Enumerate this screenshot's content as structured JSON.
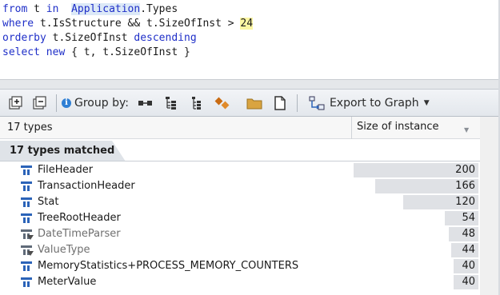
{
  "editor": {
    "lines": [
      [
        {
          "t": "from",
          "c": "kw"
        },
        {
          "t": " t ",
          "c": ""
        },
        {
          "t": "in",
          "c": "kw"
        },
        {
          "t": "  ",
          "c": ""
        },
        {
          "t": "Application",
          "c": "hl"
        },
        {
          "t": ".Types",
          "c": ""
        }
      ],
      [
        {
          "t": "where",
          "c": "kw"
        },
        {
          "t": " t.IsStructure && t.SizeOfInst > ",
          "c": ""
        },
        {
          "t": "24",
          "c": "num"
        }
      ],
      [
        {
          "t": "orderby",
          "c": "kw"
        },
        {
          "t": " t.SizeOfInst ",
          "c": ""
        },
        {
          "t": "descending",
          "c": "kw"
        }
      ],
      [
        {
          "t": "select",
          "c": "kw"
        },
        {
          "t": " ",
          "c": ""
        },
        {
          "t": "new",
          "c": "kw"
        },
        {
          "t": " { t, t.SizeOfInst }",
          "c": ""
        }
      ]
    ]
  },
  "toolbar": {
    "group_by_label": "Group by:",
    "export_label": "Export to Graph",
    "icons": [
      "expand-all-icon",
      "collapse-all-icon",
      "info-icon",
      "group-by-assembly-icon",
      "group-by-namespace-icon",
      "group-by-type-icon",
      "group-by-member-icon",
      "folder-icon",
      "document-icon",
      "export-graph-icon",
      "chevron-down-icon"
    ]
  },
  "grid": {
    "col_name_header": "17 types",
    "col_size_header": "Size of instance",
    "group_label": "17 types matched",
    "max_value": 200,
    "rows": [
      {
        "name": "FileHeader",
        "value": "200",
        "num": 200,
        "dim": false,
        "overlay": false
      },
      {
        "name": "TransactionHeader",
        "value": "166",
        "num": 166,
        "dim": false,
        "overlay": false
      },
      {
        "name": "Stat",
        "value": "120",
        "num": 120,
        "dim": false,
        "overlay": false
      },
      {
        "name": "TreeRootHeader",
        "value": "54",
        "num": 54,
        "dim": false,
        "overlay": false
      },
      {
        "name": "DateTimeParser",
        "value": "48",
        "num": 48,
        "dim": true,
        "overlay": true
      },
      {
        "name": "ValueType",
        "value": "44",
        "num": 44,
        "dim": true,
        "overlay": true
      },
      {
        "name": "MemoryStatistics+PROCESS_MEMORY_COUNTERS",
        "value": "40",
        "num": 40,
        "dim": false,
        "overlay": false
      },
      {
        "name": "MeterValue",
        "value": "40",
        "num": 40,
        "dim": false,
        "overlay": false
      }
    ]
  },
  "colors": {
    "keyword": "#1f2fc8",
    "highlight": "#dce9f7",
    "number_highlight": "#fbf6a2",
    "type_icon": "#2b63b8",
    "bar": "#dfe1e5"
  }
}
